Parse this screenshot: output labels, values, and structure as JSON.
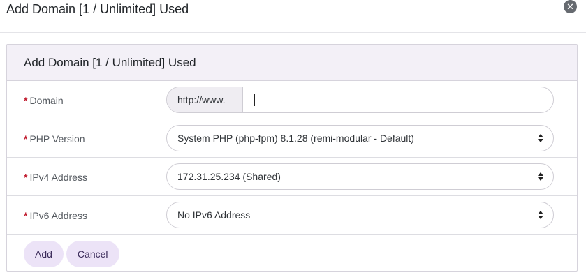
{
  "modal": {
    "title": "Add Domain [1 / Unlimited] Used",
    "close_icon": "close-icon"
  },
  "panel": {
    "title": "Add Domain [1 / Unlimited] Used"
  },
  "form": {
    "required_marker": "*",
    "domain": {
      "label": "Domain",
      "prefix": "http://www.",
      "value": ""
    },
    "php_version": {
      "label": "PHP Version",
      "selected": "System PHP (php-fpm) 8.1.28 (remi-modular - Default)"
    },
    "ipv4": {
      "label": "IPv4 Address",
      "selected": "172.31.25.234 (Shared)"
    },
    "ipv6": {
      "label": "IPv6 Address",
      "selected": "No IPv6 Address"
    }
  },
  "actions": {
    "add_label": "Add",
    "cancel_label": "Cancel"
  },
  "colors": {
    "accent_button_bg": "#ece3f7",
    "panel_header_bg": "#f3f0f7",
    "required": "#c0192c"
  }
}
